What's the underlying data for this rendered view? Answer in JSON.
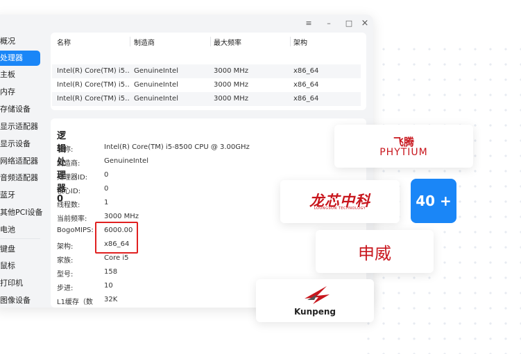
{
  "window": {
    "controls": {
      "menu": "≡",
      "minimize": "–",
      "maximize": "□",
      "close": "×"
    }
  },
  "sidebar": {
    "items": [
      {
        "label": "概况"
      },
      {
        "label": "处理器",
        "active": true
      },
      {
        "label": "主板"
      },
      {
        "label": "内存"
      },
      {
        "label": "存储设备"
      },
      {
        "label": "显示适配器"
      },
      {
        "label": "显示设备"
      },
      {
        "label": "网络适配器"
      },
      {
        "label": "音频适配器"
      },
      {
        "label": "蓝牙"
      },
      {
        "label": "其他PCI设备"
      },
      {
        "label": "电池"
      },
      {
        "label": "键盘"
      },
      {
        "label": "鼠标"
      },
      {
        "label": "打印机"
      },
      {
        "label": "图像设备"
      }
    ]
  },
  "processor_table": {
    "headers": [
      "名称",
      "制造商",
      "最大频率",
      "架构"
    ],
    "rows": [
      [
        "Intel(R) Core(TM) i5…",
        "GenuineIntel",
        "3000 MHz",
        "x86_64"
      ],
      [
        "Intel(R) Core(TM) i5…",
        "GenuineIntel",
        "3000 MHz",
        "x86_64"
      ],
      [
        "Intel(R) Core(TM) i5…",
        "GenuineIntel",
        "3000 MHz",
        "x86_64"
      ]
    ]
  },
  "details": {
    "title": "逻辑处理器 0",
    "fields": [
      {
        "label": "名称:",
        "value": "Intel(R) Core(TM) i5-8500 CPU @ 3.00GHz"
      },
      {
        "label": "制造商:",
        "value": "GenuineIntel"
      },
      {
        "label": "处理器ID:",
        "value": "0"
      },
      {
        "label": "核心ID:",
        "value": "0"
      },
      {
        "label": "线程数:",
        "value": "1"
      },
      {
        "label": "当前频率:",
        "value": "3000 MHz"
      },
      {
        "label": "BogoMIPS:",
        "value": "6000.00"
      },
      {
        "label": "架构:",
        "value": "x86_64"
      },
      {
        "label": "家族:",
        "value": "Core i5"
      },
      {
        "label": "型号:",
        "value": "158"
      },
      {
        "label": "步进:",
        "value": "10"
      },
      {
        "label": "L1缓存（数",
        "value": "32K"
      }
    ]
  },
  "logos": {
    "phytium": {
      "cn": "飞腾",
      "en": "PHYTIUM"
    },
    "loongson": {
      "cn": "龙芯中科",
      "en": "LOONGSON TECHNOLOGY"
    },
    "count": "40 +",
    "sunway": "申威",
    "kunpeng": "Kunpeng"
  },
  "colors": {
    "accent": "#1a86f7",
    "highlight": "#e02020",
    "brand_red": "#c8161d"
  }
}
